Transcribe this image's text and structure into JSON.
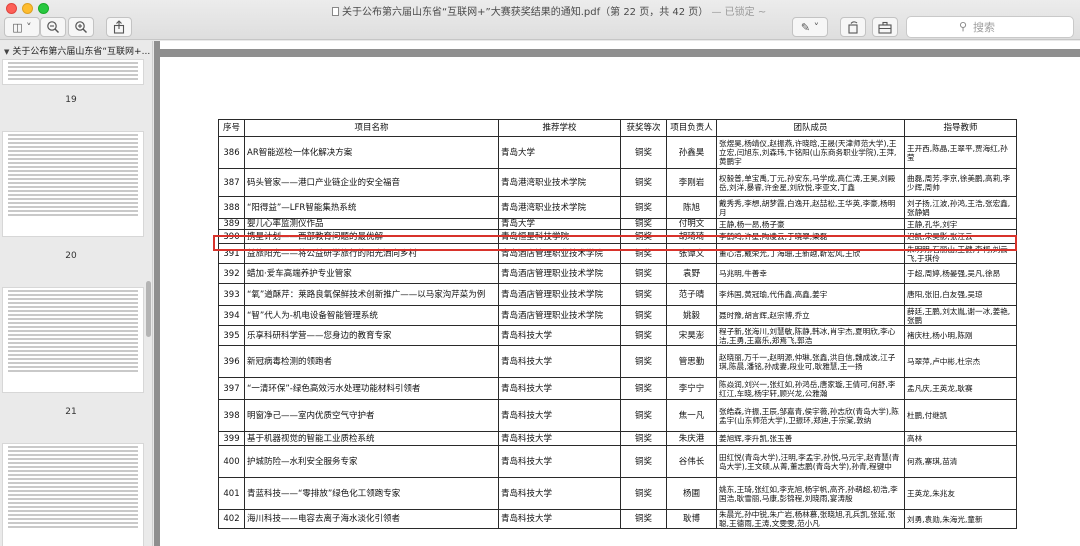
{
  "window": {
    "title": "关于公布第六届山东省“互联网+”大赛获奖结果的通知.pdf（第 22 页，共 42 页）",
    "locked": "— 已锁定 ~"
  },
  "toolbar": {
    "buttons": [
      "sidebar-toggle-icon",
      "zoom-out-icon",
      "zoom-in-icon",
      "share-icon",
      "markup-pen-icon",
      "rotate-icon",
      "toolbox-icon"
    ],
    "search_placeholder": "搜索"
  },
  "sidebar": {
    "doc_title": "关于公布第六届山东省“互联网+...",
    "pages": [
      "19",
      "20",
      "21"
    ]
  },
  "table": {
    "headers": [
      "序号",
      "项目名称",
      "推荐学校",
      "获奖等次",
      "项目负责人",
      "团队成员",
      "指导教师"
    ],
    "rows": [
      [
        "386",
        "AR智能巡检一体化解决方案",
        "青岛大学",
        "铜奖",
        "孙鑫昊",
        "张煜昊,杨靖仪,赵振燕,许晓晗,王晟(天津师范大学),王立宏,闫旭东,刘森玮,卞铭阳(山东商务职业学院),王萍,黄鹏宇",
        "王开西,陈晶,王翠平,贾海红,孙莹"
      ],
      [
        "387",
        "码头管家——港口产业链企业的安全福音",
        "青岛港湾职业技术学院",
        "铜奖",
        "李刚岩",
        "权毅普,单宝禹,丁元,孙安东,马学成,高仁涛,王昊,刘殿岳,刘洋,暴睿,许金星,刘欣悦,李亚文,丁鑫",
        "曲磊,周芳,李京,徐美鹏,高莉,李少辉,周帅"
      ],
      [
        "388",
        "“阳得益”—LFR智能集热系统",
        "青岛港湾职业技术学院",
        "铜奖",
        "陈旭",
        "戴秀秀,李想,胡梦霞,白逸开,赵喆松,王华英,李豪,杨明月",
        "刘子扬,江波,孙鸿,王浩,张宏鑫,张静娟"
      ],
      [
        "389",
        "婴儿心率监测仪作品",
        "青岛大学",
        "铜奖",
        "付明文",
        "王静,杨一昂,杨子豪",
        "王静,孔华,刘宇"
      ],
      [
        "390",
        "携星计划——西部教育问题的最优解",
        "青岛恒星科技学院",
        "铜奖",
        "胡琦琦",
        "李鹤鸣,许星,陶凌云,于晓翠,梁磊",
        "迟凯,宋吴影,张江云"
      ],
      [
        "391",
        "益旅阳光——将公益研学旅行的阳光洒向乡村",
        "青岛酒店管理职业技术学院",
        "铜奖",
        "张谭文",
        "董心洁,戴荣光,丁海珊,王新越,靳宏风,王欣",
        "朱明明,石丽山,王健,李柯,刘云飞,于琪伶"
      ],
      [
        "392",
        "蜡加·爱车高端养护专业管家",
        "青岛酒店管理职业技术学院",
        "铜奖",
        "袁野",
        "马兆明,牛善幸",
        "于超,周婷,杨晏强,吴凡,徐昂"
      ],
      [
        "393",
        "“氧”道酥芹：莱路良氧保鲜技术创新推广——以马家沟芹菜为例",
        "青岛酒店管理职业技术学院",
        "铜奖",
        "范子晴",
        "李炜国,黄冠瑜,代伟鑫,高鑫,姜宇",
        "唐阳,张旧,白友强,吴琼"
      ],
      [
        "394",
        "“智”代人为-机电设备智能管理系统",
        "青岛酒店管理职业技术学院",
        "铜奖",
        "姚毅",
        "聂时豫,胡言辉,赵宗博,乔立",
        "薛廷,王鹏,刘太胤,谢一冰,姜艳,张鹏"
      ],
      [
        "395",
        "乐享科研科学营——您身边的教育专家",
        "青岛科技大学",
        "铜奖",
        "宋昊澎",
        "程子新,张海川,刘慧敏,陈静,韩冰,肖宇杰,夏明欣,李心洁,王勇,王嘉乐,郑焉飞,郭浩",
        "褚庆柱,杨小明,陈刚"
      ],
      [
        "396",
        "新冠病毒检测的领跑者",
        "青岛科技大学",
        "铜奖",
        "管思勤",
        "赵晓丽,万千一,赵明源,仲琳,张鑫,洪自信,魏成波,江子琪,陈晨,潘铭,孙成妻,段业可,耿雅慧,王一扬",
        "马翠萍,卢中彬,杜宗杰"
      ],
      [
        "397",
        "“一清环保”-绿色高效污水处理功能材料引领者",
        "青岛科技大学",
        "铜奖",
        "李宁宁",
        "陈焱润,刘兴一,张红如,孙鸿岳,唐家璇,王倩可,何舒,李红江,车晓,杨宇轩,顾兴龙,公雅瀚",
        "孟凡庆,王英龙,耿赛"
      ],
      [
        "398",
        "明窗净己——室内优质空气守护者",
        "青岛科技大学",
        "铜奖",
        "焦一凡",
        "张皓森,许振,王辰,邹嘉青,侯宇薇,孙志欣(青岛大学),陈孟宇(山东师范大学),卫振环,郑迪,于宗棠,敦纳",
        "杜鹏,付继凯"
      ],
      [
        "399",
        "基于机器视觉的智能工业质检系统",
        "青岛科技大学",
        "铜奖",
        "朱庆港",
        "姜旭辉,李升凯,张玉善",
        "高林"
      ],
      [
        "400",
        "护城防险—水利安全服务专家",
        "青岛科技大学",
        "铜奖",
        "谷伟长",
        "田红悦(青岛大学),汪明,李孟宇,孙悦,马元宇,赵青慧(青岛大学),王文硕,从菁,董志鹏(青岛大学),孙青,程键中",
        "何燕,寨琪,苗清"
      ],
      [
        "401",
        "青蓝科技——“零排放”绿色化工领跑专家",
        "青岛科技大学",
        "铜奖",
        "杨圃",
        "姚东,王琦,张红如,李克旭,杨宇帆,高齐,孙萌超,初浩,李国浩,耿雪丽,马康,彭锦程,刘晓雨,宴涛殷",
        "王英龙,朱兆友"
      ],
      [
        "402",
        "海川科技——电容去离子海水淡化引领者",
        "青岛科技大学",
        "铜奖",
        "耿博",
        "朱晨光,孙中锐,朱广岩,杨林慕,张晓旭,孔兵凯,张延,张聪,王德雨,王涛,文雯雯,范小凡",
        "刘勇,袁勋,朱海光,童新"
      ]
    ]
  }
}
